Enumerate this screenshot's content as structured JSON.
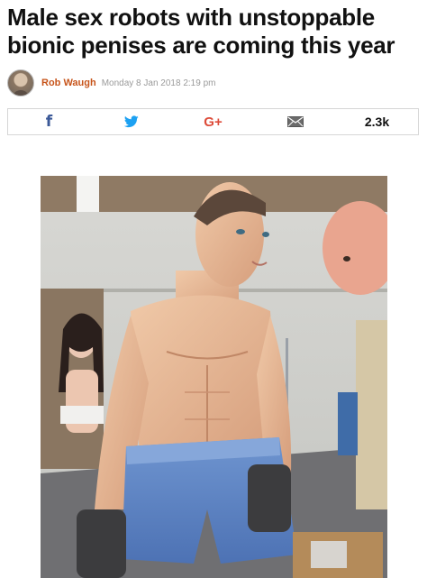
{
  "article": {
    "headline": "Male sex robots with unstoppable bionic penises are coming this year",
    "author": "Rob Waugh",
    "date": "Monday 8 Jan 2018 2:19 pm"
  },
  "share": {
    "facebook_icon": "f",
    "google_plus_icon": "G+",
    "count": "2.3k",
    "icons": [
      "facebook-icon",
      "twitter-icon",
      "google-plus-icon",
      "email-icon"
    ]
  },
  "colors": {
    "author": "#c7541a",
    "facebook": "#3b5998",
    "twitter": "#1da1f2",
    "google_plus": "#dd4b39",
    "email": "#555555"
  },
  "image": {
    "subject": "male-robot-photo"
  }
}
